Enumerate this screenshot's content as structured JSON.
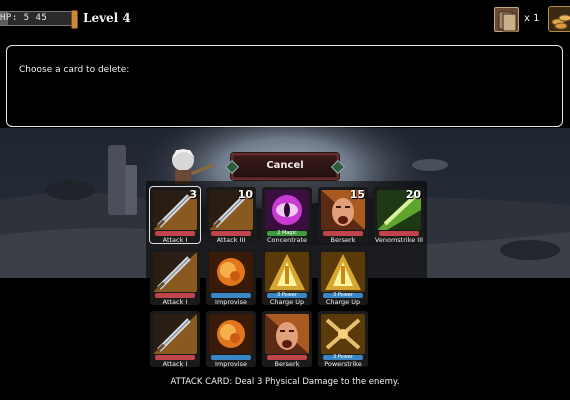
{
  "hud": {
    "hp_text": "HP: 5 45",
    "hp_fraction": 0.11,
    "level_label": "Level 4",
    "deck_icon": "card-deck-icon",
    "deck_count": "x 1",
    "gold_icon": "gold-coins-icon"
  },
  "dialog": {
    "prompt": "Choose a card to delete:"
  },
  "cancel": {
    "label": "Cancel"
  },
  "cards": [
    {
      "name": "Attack I",
      "cost": "3",
      "art": "sword",
      "bar_color": "#c0454a",
      "bar_text": "",
      "selected": true
    },
    {
      "name": "Attack III",
      "cost": "10",
      "art": "sword",
      "bar_color": "#c0454a",
      "bar_text": ""
    },
    {
      "name": "Concentrate",
      "cost": "",
      "art": "eye",
      "bar_color": "#3f9a43",
      "bar_text": "2 Magic"
    },
    {
      "name": "Berserk",
      "cost": "15",
      "art": "face",
      "bar_color": "#c0454a",
      "bar_text": ""
    },
    {
      "name": "Venomstrike III",
      "cost": "20",
      "art": "venom",
      "bar_color": "#c0454a",
      "bar_text": ""
    },
    {
      "name": "Attack I",
      "cost": "",
      "art": "sword",
      "bar_color": "#c0454a",
      "bar_text": ""
    },
    {
      "name": "Improvise",
      "cost": "",
      "art": "fire",
      "bar_color": "#3b86c4",
      "bar_text": ""
    },
    {
      "name": "Charge Up",
      "cost": "",
      "art": "charge",
      "bar_color": "#3b86c4",
      "bar_text": "3 Power"
    },
    {
      "name": "Charge Up",
      "cost": "",
      "art": "charge",
      "bar_color": "#3b86c4",
      "bar_text": "3 Power"
    },
    {
      "name": "Attack I",
      "cost": "",
      "art": "sword",
      "bar_color": "#c0454a",
      "bar_text": ""
    },
    {
      "name": "Improvise",
      "cost": "",
      "art": "fire",
      "bar_color": "#3b86c4",
      "bar_text": ""
    },
    {
      "name": "Berserk",
      "cost": "",
      "art": "face",
      "bar_color": "#c0454a",
      "bar_text": ""
    },
    {
      "name": "Powerstrike",
      "cost": "",
      "art": "swords",
      "bar_color": "#3b86c4",
      "bar_text": "3 Power"
    }
  ],
  "description": "ATTACK CARD: Deal 3 Physical Damage to the enemy.",
  "colors": {
    "dialog_border": "#e6e6e6",
    "cancel_bg": "#2e1414",
    "attack_bar": "#c0454a",
    "skill_bar": "#3b86c4",
    "magic_bar": "#3f9a43"
  }
}
